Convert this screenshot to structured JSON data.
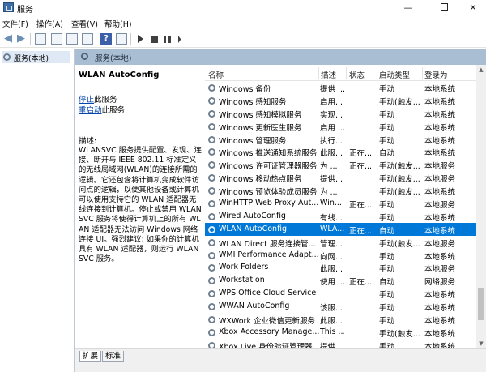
{
  "window": {
    "title": "服务"
  },
  "menu": [
    "文件(F)",
    "操作(A)",
    "查看(V)",
    "帮助(H)"
  ],
  "toolbar": {
    "icons": [
      "back-arrow",
      "forward-arrow",
      "console-tree",
      "properties",
      "refresh",
      "export-list",
      "help",
      "properties-sheet",
      "start",
      "stop",
      "pause",
      "restart"
    ],
    "help_glyph": "?"
  },
  "tree": {
    "root_label": "服务(本地)"
  },
  "pane": {
    "title": "服务(本地)"
  },
  "details": {
    "service_name": "WLAN AutoConfig",
    "stop_link": "停止",
    "stop_suffix": "此服务",
    "restart_link": "重启动",
    "restart_suffix": "此服务",
    "desc_label": "描述:",
    "description": "WLANSVC 服务提供配置、发现、连接、断开与 IEEE 802.11 标准定义的无线局域网(WLAN)的连接所需的逻辑。它还包含将计算机变成软件访问点的逻辑，以便其他设备或计算机可以使用支持它的 WLAN 适配器无线连接到计算机。停止或禁用 WLANSVC 服务将使得计算机上的所有 WLAN 适配器无法访问 Windows 网络连接 UI。强烈建议: 如果你的计算机具有 WLAN 适配器，则运行 WLANSVC 服务。"
  },
  "columns": {
    "name": "名称",
    "desc": "描述",
    "status": "状态",
    "startup": "启动类型",
    "logon": "登录为"
  },
  "rows": [
    {
      "name": "Windows 备份",
      "desc": "提供 ...",
      "status": "",
      "startup": "手动",
      "logon": "本地系统"
    },
    {
      "name": "Windows 感知服务",
      "desc": "启用...",
      "status": "",
      "startup": "手动(触发...",
      "logon": "本地系统"
    },
    {
      "name": "Windows 感知模拟服务",
      "desc": "实现...",
      "status": "",
      "startup": "手动",
      "logon": "本地系统"
    },
    {
      "name": "Windows 更新医生服务",
      "desc": "启用 ...",
      "status": "",
      "startup": "手动",
      "logon": "本地系统"
    },
    {
      "name": "Windows 管理服务",
      "desc": "执行...",
      "status": "",
      "startup": "手动",
      "logon": "本地系统"
    },
    {
      "name": "Windows 推送通知系统服务",
      "desc": "此服...",
      "status": "正在...",
      "startup": "自动",
      "logon": "本地系统"
    },
    {
      "name": "Windows 许可证管理器服务",
      "desc": "为 ...",
      "status": "正在...",
      "startup": "手动(触发...",
      "logon": "本地服务"
    },
    {
      "name": "Windows 移动热点服务",
      "desc": "提供...",
      "status": "",
      "startup": "手动(触发...",
      "logon": "本地服务"
    },
    {
      "name": "Windows 预览体验成员服务",
      "desc": "为 ...",
      "status": "",
      "startup": "手动(触发...",
      "logon": "本地系统"
    },
    {
      "name": "WinHTTP Web Proxy Aut...",
      "desc": "Win...",
      "status": "正在...",
      "startup": "手动",
      "logon": "本地服务"
    },
    {
      "name": "Wired AutoConfig",
      "desc": "有线...",
      "status": "",
      "startup": "手动",
      "logon": "本地系统"
    },
    {
      "name": "WLAN AutoConfig",
      "desc": "WLA...",
      "status": "正在...",
      "startup": "自动",
      "logon": "本地系统",
      "selected": true
    },
    {
      "name": "WLAN Direct 服务连接管...",
      "desc": "管理...",
      "status": "",
      "startup": "手动(触发...",
      "logon": "本地服务"
    },
    {
      "name": "WMI Performance Adapt...",
      "desc": "向网...",
      "status": "",
      "startup": "手动",
      "logon": "本地系统"
    },
    {
      "name": "Work Folders",
      "desc": "此服...",
      "status": "",
      "startup": "手动",
      "logon": "本地服务"
    },
    {
      "name": "Workstation",
      "desc": "使用 ...",
      "status": "正在...",
      "startup": "自动",
      "logon": "网络服务"
    },
    {
      "name": "WPS Office Cloud Service",
      "desc": "",
      "status": "",
      "startup": "手动",
      "logon": "本地系统"
    },
    {
      "name": "WWAN AutoConfig",
      "desc": "该服...",
      "status": "",
      "startup": "手动",
      "logon": "本地系统"
    },
    {
      "name": "WXWork 企业微信更新服务",
      "desc": "此服...",
      "status": "",
      "startup": "手动",
      "logon": "本地系统"
    },
    {
      "name": "Xbox Accessory Manage...",
      "desc": "This ...",
      "status": "",
      "startup": "手动(触发...",
      "logon": "本地系统"
    },
    {
      "name": "Xbox Live 身份验证管理器",
      "desc": "提供...",
      "status": "",
      "startup": "手动",
      "logon": "本地系统"
    }
  ],
  "tabs": {
    "extended": "扩展",
    "standard": "标准"
  },
  "colors": {
    "selection": "#0078d7",
    "pane_header": "#a9bdd3",
    "tree_selected": "#dfe9f5"
  }
}
